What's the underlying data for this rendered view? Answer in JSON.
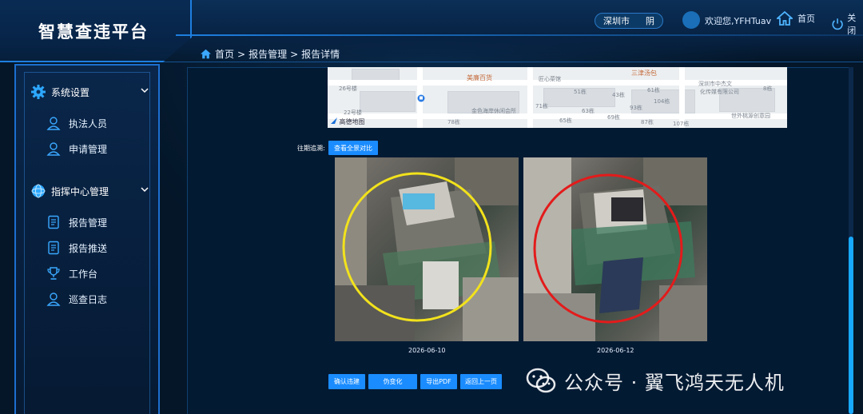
{
  "header": {
    "title": "智慧查违平台",
    "weather_city": "深圳市",
    "weather_status": "阴",
    "greeting": "欢迎您,YFHTuav",
    "home_label": "首页",
    "logout_label": "关闭"
  },
  "breadcrumb": {
    "home": "首页",
    "separator": ">",
    "level2": "报告管理",
    "level3": "报告详情"
  },
  "sidebar": {
    "groups": [
      {
        "label": "系统设置",
        "icon": "gear-icon",
        "items": [
          {
            "label": "执法人员",
            "icon": "person-icon"
          },
          {
            "label": "申请管理",
            "icon": "person-icon"
          }
        ]
      },
      {
        "label": "指挥中心管理",
        "icon": "globe-icon",
        "items": [
          {
            "label": "报告管理",
            "icon": "report-icon"
          },
          {
            "label": "报告推送",
            "icon": "report-icon"
          },
          {
            "label": "工作台",
            "icon": "trophy-icon"
          },
          {
            "label": "巡查日志",
            "icon": "person-icon"
          }
        ]
      }
    ]
  },
  "map": {
    "labels": {
      "l1": "26号楼",
      "l2": "22号楼",
      "l3": "美廉百货",
      "l4": "匠心菜馆",
      "l5": "三津汤包",
      "l6": "深圳市中杰文",
      "l7": "化传媒有限公司",
      "l8": "金色海岸休闲会所",
      "l9": "世外桃源创意园",
      "l10": "高德地图",
      "n71": "71栋",
      "n51": "51栋",
      "n43": "43栋",
      "n61": "61栋",
      "n104": "104栋",
      "n93": "93栋",
      "n63": "63栋",
      "n65": "65栋",
      "n69": "69栋",
      "n78": "78栋",
      "n87": "87栋",
      "n107": "107栋",
      "n8": "8栋"
    },
    "accent_poi": "#c46a3b"
  },
  "track": {
    "label": "往期追溯:",
    "compare_button": "查看全景对比"
  },
  "photos": [
    {
      "date": "2026-06-10",
      "circle_color": "#f2e21c"
    },
    {
      "date": "2026-06-12",
      "circle_color": "#e31b1b"
    }
  ],
  "actions": {
    "confirm": "确认违建",
    "false_change": "伪变化",
    "export_pdf": "导出PDF",
    "back": "返回上一页"
  },
  "watermark": {
    "text": "公众号 · 翼飞鸿天无人机"
  },
  "colors": {
    "accent": "#1a8cff",
    "background": "#041628",
    "frame": "#1d6fd0"
  }
}
